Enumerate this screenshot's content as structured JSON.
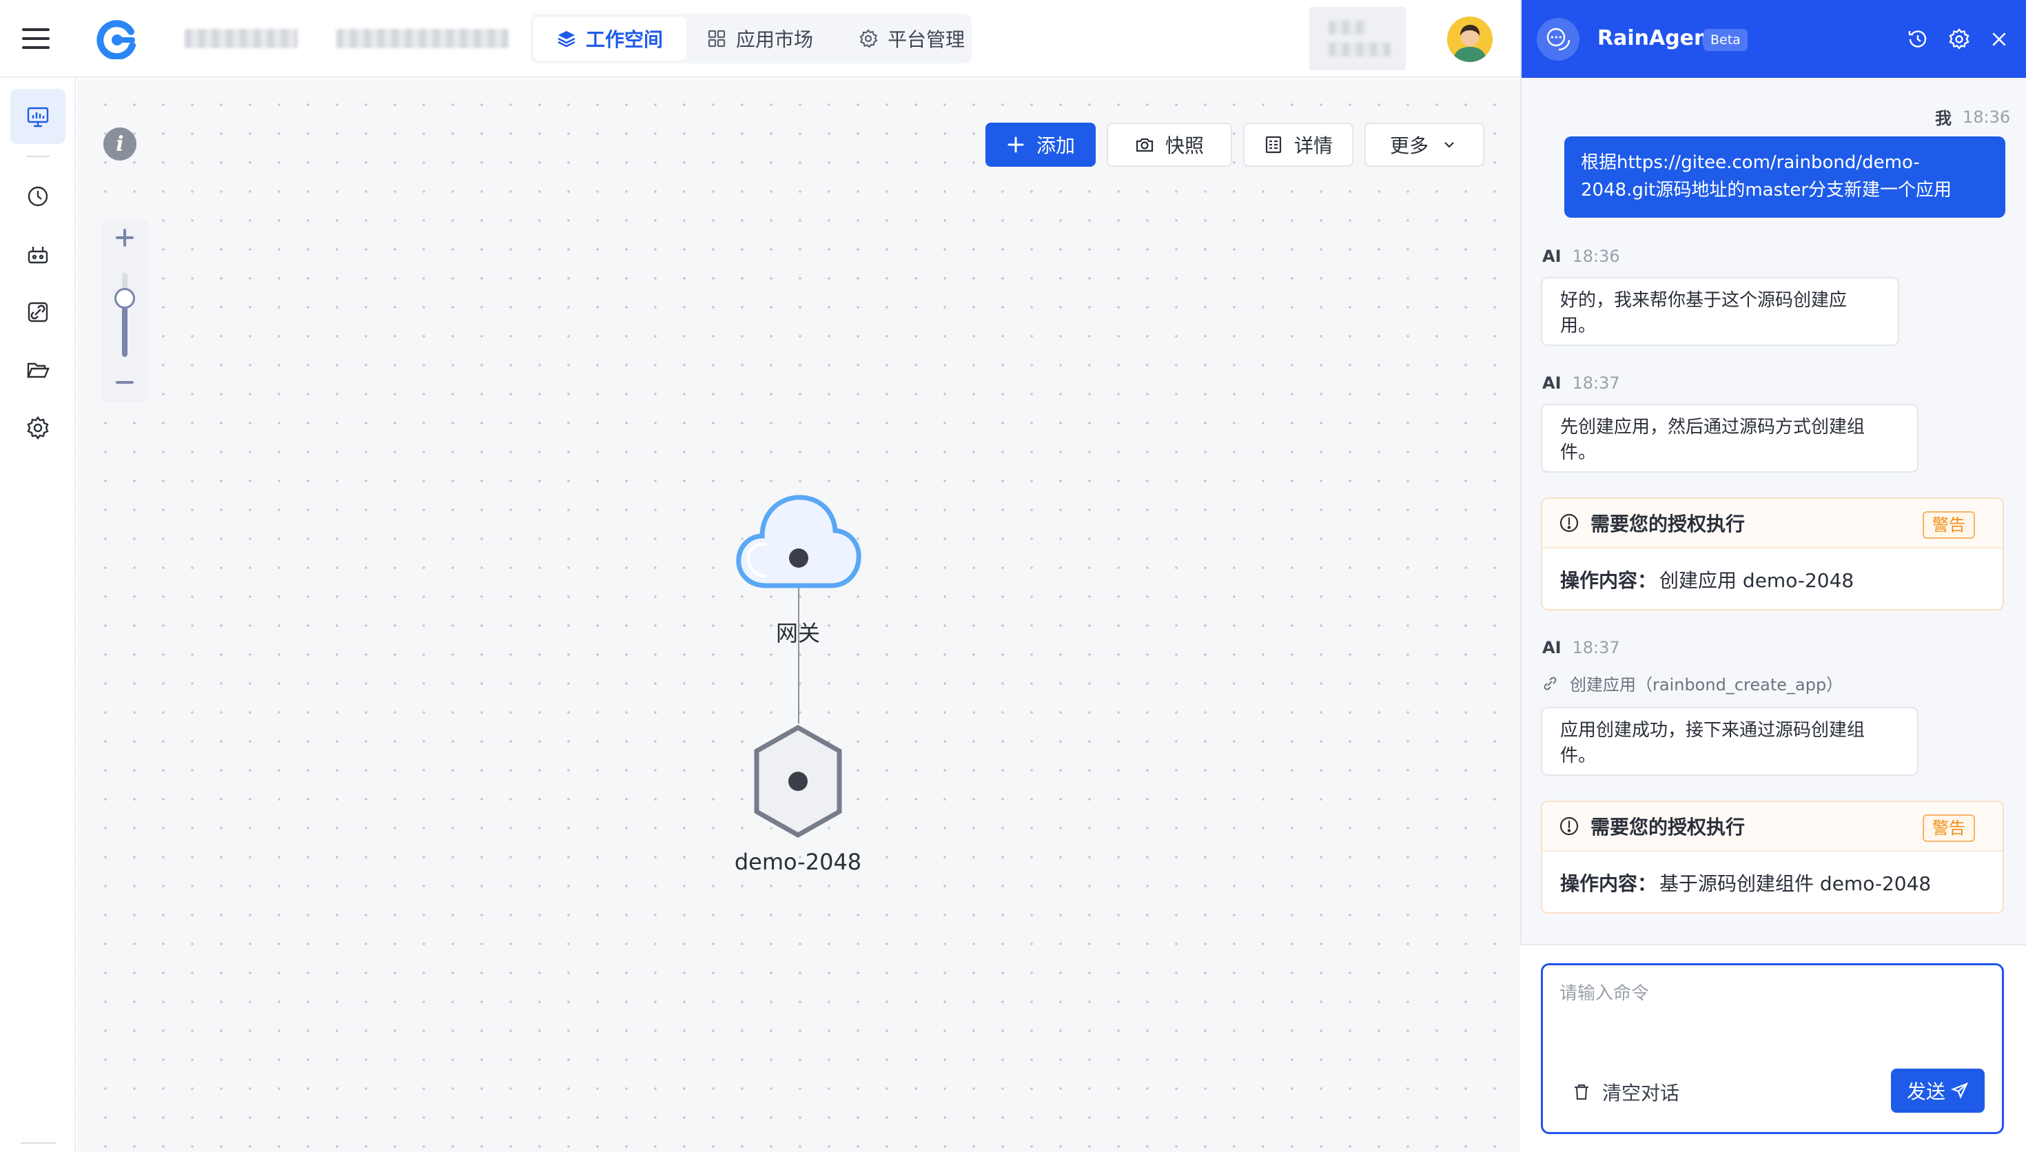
{
  "header": {
    "nav": [
      {
        "label": "工作空间",
        "icon": "layers-icon",
        "active": true
      },
      {
        "label": "应用市场",
        "icon": "grid-icon",
        "active": false
      },
      {
        "label": "平台管理",
        "icon": "gear-icon",
        "active": false
      }
    ]
  },
  "sidebar": {
    "items": [
      {
        "name": "monitor-icon",
        "active": true
      },
      {
        "name": "clock-icon",
        "active": false
      },
      {
        "name": "robot-icon",
        "active": false
      },
      {
        "name": "link-icon",
        "active": false
      },
      {
        "name": "folder-icon",
        "active": false
      },
      {
        "name": "gear-icon",
        "active": false
      }
    ]
  },
  "toolbar": {
    "add": "添加",
    "snapshot": "快照",
    "details": "详情",
    "more": "更多"
  },
  "graph": {
    "gateway_label": "网关",
    "component_label": "demo-2048"
  },
  "agent": {
    "title": "RainAgent",
    "badge": "Beta",
    "messages": {
      "user_who": "我",
      "user_time": "18:36",
      "user_text": "根据https://gitee.com/rainbond/demo-2048.git源码地址的master分支新建一个应用",
      "ai1_who": "AI",
      "ai1_time": "18:36",
      "ai1_text": "好的，我来帮你基于这个源码创建应用。",
      "ai2_who": "AI",
      "ai2_time": "18:37",
      "ai2_text": "先创建应用，然后通过源码方式创建组件。",
      "auth1_title": "需要您的授权执行",
      "auth1_tag": "警告",
      "auth1_label": "操作内容：",
      "auth1_value": "创建应用 demo-2048",
      "ai3_who": "AI",
      "ai3_time": "18:37",
      "tool_call": "创建应用（rainbond_create_app）",
      "ai3_text": "应用创建成功，接下来通过源码创建组件。",
      "auth2_title": "需要您的授权执行",
      "auth2_tag": "警告",
      "auth2_label": "操作内容：",
      "auth2_value": "基于源码创建组件 demo-2048"
    },
    "input_placeholder": "请输入命令",
    "clear": "清空对话",
    "send": "发送"
  },
  "colors": {
    "primary": "#1e5be8",
    "agent_header": "#2153ee",
    "warning": "#f08c1a"
  }
}
